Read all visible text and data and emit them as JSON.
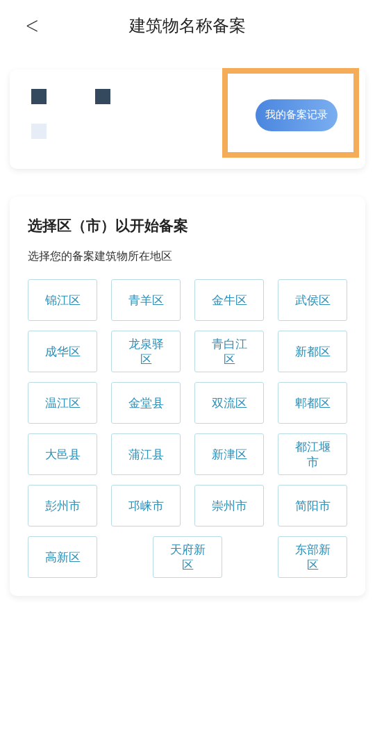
{
  "header": {
    "title": "建筑物名称备案",
    "back": "<"
  },
  "record_card": {
    "button": "我的备案记录"
  },
  "region_card": {
    "title": "选择区（市）以开始备案",
    "subtitle": "选择您的备案建筑物所在地区",
    "regions": [
      "锦江区",
      "青羊区",
      "金牛区",
      "武侯区",
      "成华区",
      "龙泉驿区",
      "青白江区",
      "新都区",
      "温江区",
      "金堂县",
      "双流区",
      "郫都区",
      "大邑县",
      "蒲江县",
      "新津区",
      "都江堰市",
      "彭州市",
      "邛崃市",
      "崇州市",
      "简阳市",
      "高新区",
      "天府新区",
      "东部新区"
    ]
  }
}
